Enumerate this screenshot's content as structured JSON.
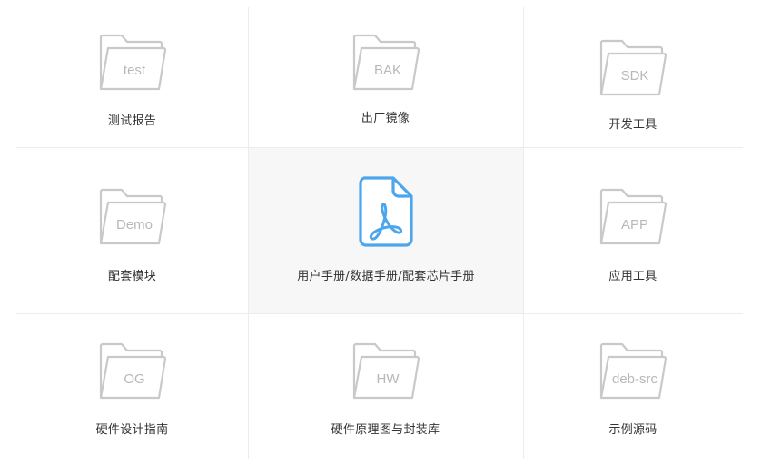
{
  "colors": {
    "folder_stroke": "#c9c9c9",
    "pdf_accent": "#4da6ec",
    "active_bg": "#f7f7f7",
    "divider": "#ececec"
  },
  "tiles": [
    {
      "label": "测试报告",
      "icon": "folder-icon",
      "icon_text": "test"
    },
    {
      "label": "出厂镜像",
      "icon": "folder-icon",
      "icon_text": "BAK"
    },
    {
      "label": "开发工具",
      "icon": "folder-icon",
      "icon_text": "SDK"
    },
    {
      "label": "配套模块",
      "icon": "folder-icon",
      "icon_text": "Demo"
    },
    {
      "label": "用户手册/数据手册/配套芯片手册",
      "icon": "pdf-file-icon",
      "icon_text": ""
    },
    {
      "label": "应用工具",
      "icon": "folder-icon",
      "icon_text": "APP"
    },
    {
      "label": "硬件设计指南",
      "icon": "folder-icon",
      "icon_text": "OG"
    },
    {
      "label": "硬件原理图与封装库",
      "icon": "folder-icon",
      "icon_text": "HW"
    },
    {
      "label": "示例源码",
      "icon": "folder-icon",
      "icon_text": "deb-src"
    }
  ]
}
